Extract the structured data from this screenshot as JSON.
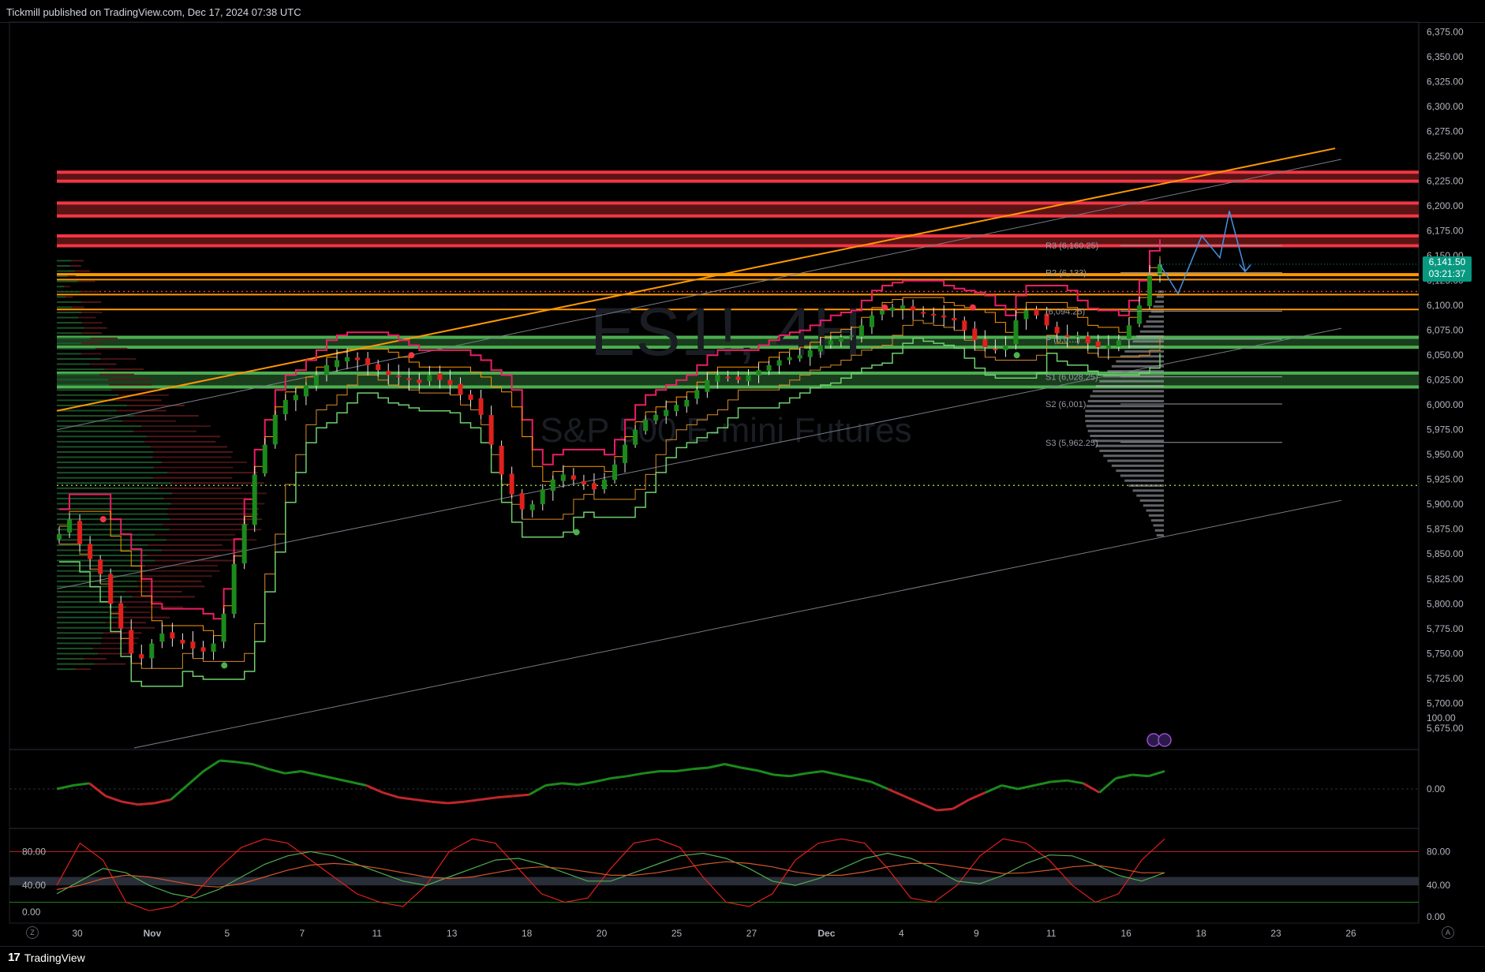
{
  "header": {
    "published_by": "Tickmill published on TradingView.com, Dec 17, 2024 07:38 UTC"
  },
  "footer": {
    "brand_mark": "17",
    "brand_name": "TradingView",
    "btn_left": "Z",
    "btn_right": "A"
  },
  "watermark": {
    "symbol": "ES1!, 4H",
    "name": "S&P 500 E-mini Futures"
  },
  "last_price": {
    "value": "6,141.50",
    "countdown": "03:21:37"
  },
  "colors": {
    "up": "#1b8a1b",
    "down": "#e0201c",
    "resistance": "#f23645",
    "support": "#4caf50",
    "orange": "#ff9800",
    "pink": "#e91e63",
    "projection": "#4a90e2"
  },
  "pivots": [
    {
      "label": "R3 (6,160.25)",
      "price": 6160.25
    },
    {
      "label": "R2 (6,133)",
      "price": 6133
    },
    {
      "label": "(6,094.25)",
      "price": 6094.25
    },
    {
      "label": "P (6,0…)",
      "price": 6066
    },
    {
      "label": "S1 (6,028.25)",
      "price": 6028.25
    },
    {
      "label": "S2 (6,001)",
      "price": 6001
    },
    {
      "label": "S3 (5,962.25)",
      "price": 5962.25
    }
  ],
  "chart_data": [
    {
      "type": "line",
      "title": "ES1!, 4H",
      "subtitle": "S&P 500 E-mini Futures",
      "ylim": [
        5655,
        6385
      ],
      "y_ticks": [
        "6,375.00",
        "6,350.00",
        "6,325.00",
        "6,300.00",
        "6,275.00",
        "6,250.00",
        "6,225.00",
        "6,200.00",
        "6,175.00",
        "6,150.00",
        "6,125.00",
        "6,100.00",
        "6,075.00",
        "6,050.00",
        "6,025.00",
        "6,000.00",
        "5,975.00",
        "5,950.00",
        "5,925.00",
        "5,900.00",
        "5,875.00",
        "5,850.00",
        "5,825.00",
        "5,800.00",
        "5,775.00",
        "5,750.00",
        "5,725.00",
        "5,700.00",
        "5,675.00"
      ],
      "x_ticks": [
        "30",
        "Nov",
        "5",
        "7",
        "11",
        "13",
        "18",
        "20",
        "25",
        "27",
        "Dec",
        "4",
        "9",
        "11",
        "16",
        "18",
        "23",
        "26"
      ],
      "series": [
        {
          "values": [
            5870,
            5885,
            5860,
            5845,
            5830,
            5800,
            5775,
            5750,
            5745,
            5760,
            5770,
            5765,
            5760,
            5755,
            5752,
            5760,
            5790,
            5840,
            5880,
            5930,
            5960,
            5990,
            6005,
            6010,
            6020,
            6030,
            6040,
            6045,
            6048,
            6045,
            6040,
            6035,
            6030,
            6028,
            6025,
            6022,
            6030,
            6025,
            6020,
            6010,
            6005,
            5990,
            5960,
            5930,
            5910,
            5895,
            5900,
            5915,
            5925,
            5930,
            5925,
            5920,
            5915,
            5925,
            5940,
            5960,
            5975,
            5985,
            5990,
            5995,
            6000,
            6005,
            6015,
            6025,
            6030,
            6028,
            6025,
            6030,
            6035,
            6040,
            6045,
            6048,
            6050,
            6055,
            6060,
            6065,
            6068,
            6070,
            6080,
            6090,
            6095,
            6098,
            6100,
            6095,
            6092,
            6090,
            6088,
            6085,
            6075,
            6065,
            6058,
            6055,
            6060,
            6085,
            6095,
            6090,
            6080,
            6072,
            6068,
            6070,
            6062,
            6058,
            6060,
            6065,
            6080,
            6100,
            6130,
            6141.5
          ]
        }
      ],
      "resistance_zones": [
        [
          6225,
          6234
        ],
        [
          6190,
          6203
        ],
        [
          6160,
          6170
        ]
      ],
      "orange_levels": [
        6131,
        6126,
        6111,
        6096
      ],
      "support_zones": [
        [
          6058,
          6068
        ],
        [
          6018,
          6032
        ]
      ],
      "dotted_levels": [
        6114,
        5919
      ]
    },
    {
      "type": "line",
      "y_ticks": [
        "100.00",
        "0.00"
      ],
      "series": [
        {
          "values": [
            0,
            5,
            8,
            -10,
            -18,
            -22,
            -20,
            -15,
            5,
            25,
            40,
            38,
            35,
            28,
            22,
            25,
            20,
            15,
            10,
            5,
            -5,
            -12,
            -15,
            -18,
            -20,
            -18,
            -15,
            -12,
            -10,
            -8,
            5,
            8,
            6,
            10,
            15,
            18,
            22,
            25,
            25,
            28,
            30,
            35,
            30,
            26,
            20,
            18,
            22,
            25,
            20,
            15,
            10,
            0,
            -10,
            -20,
            -30,
            -28,
            -15,
            -5,
            5,
            0,
            5,
            10,
            12,
            8,
            -5,
            15,
            20,
            18,
            25
          ]
        }
      ]
    },
    {
      "type": "line",
      "y_ticks": [
        "80.00",
        "40.00",
        "0.00"
      ],
      "series": [
        {
          "values": [
            40,
            90,
            70,
            20,
            10,
            15,
            30,
            60,
            85,
            95,
            90,
            70,
            50,
            30,
            20,
            15,
            40,
            80,
            95,
            90,
            60,
            30,
            20,
            25,
            60,
            90,
            95,
            85,
            50,
            20,
            15,
            30,
            70,
            90,
            95,
            90,
            60,
            25,
            20,
            40,
            75,
            95,
            90,
            70,
            40,
            20,
            30,
            70,
            95
          ]
        },
        {
          "values": [
            30,
            45,
            60,
            55,
            40,
            30,
            25,
            35,
            50,
            65,
            75,
            80,
            75,
            65,
            55,
            45,
            40,
            50,
            60,
            70,
            72,
            65,
            55,
            45,
            45,
            55,
            65,
            75,
            78,
            72,
            60,
            45,
            40,
            48,
            60,
            72,
            78,
            72,
            60,
            45,
            42,
            52,
            66,
            76,
            75,
            65,
            52,
            45,
            55
          ]
        },
        {
          "values": [
            35,
            40,
            48,
            52,
            50,
            45,
            40,
            38,
            42,
            50,
            58,
            64,
            66,
            64,
            60,
            55,
            50,
            48,
            50,
            55,
            60,
            62,
            60,
            56,
            52,
            52,
            55,
            60,
            65,
            68,
            66,
            62,
            56,
            52,
            52,
            56,
            62,
            66,
            66,
            62,
            58,
            54,
            55,
            58,
            62,
            64,
            60,
            55,
            55
          ]
        }
      ]
    }
  ]
}
